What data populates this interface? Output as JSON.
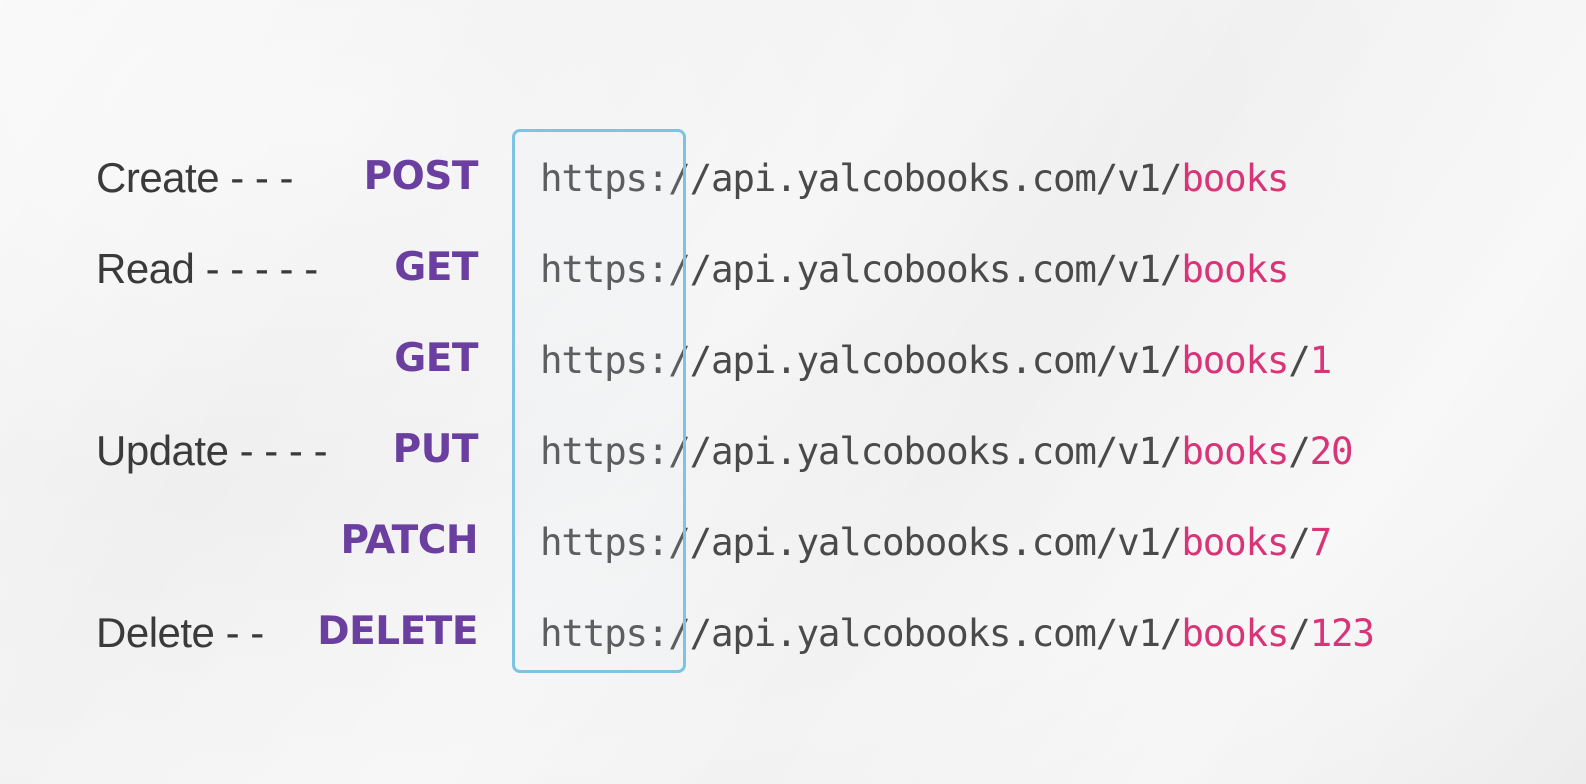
{
  "rows": [
    {
      "crud": "Create - - -",
      "method": "POST",
      "url_base": "https://api.yalcobooks.com/v1/",
      "resource": "books",
      "suffix": ""
    },
    {
      "crud": "Read - - - - -",
      "method": "GET",
      "url_base": "https://api.yalcobooks.com/v1/",
      "resource": "books",
      "suffix": ""
    },
    {
      "crud": "",
      "method": "GET",
      "url_base": "https://api.yalcobooks.com/v1/",
      "resource": "books",
      "suffix": "/1"
    },
    {
      "crud": "Update - - - -",
      "method": "PUT",
      "url_base": "https://api.yalcobooks.com/v1/",
      "resource": "books",
      "suffix": "/20"
    },
    {
      "crud": "",
      "method": "PATCH",
      "url_base": "https://api.yalcobooks.com/v1/",
      "resource": "books",
      "suffix": "/7"
    },
    {
      "crud": "Delete - -",
      "method": "DELETE",
      "url_base": "https://api.yalcobooks.com/v1/",
      "resource": "books",
      "suffix": "/123"
    }
  ],
  "colors": {
    "method": "#6b3fa0",
    "resource": "#d93478",
    "url": "#4a4a4a",
    "crud": "#3a3a3a",
    "highlight_border": "#7ec3e3"
  }
}
